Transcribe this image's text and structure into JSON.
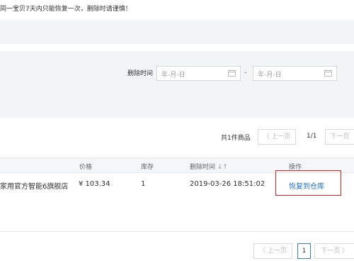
{
  "notice": "同一宝贝7天内只能恢复一次，删除时请谨慎！",
  "filter": {
    "label": "删除时间",
    "start_placeholder": "年-月-日",
    "end_placeholder": "年-月-日",
    "separator": "-"
  },
  "summary": {
    "count_text": "共1件商品",
    "page_indicator": "1/1"
  },
  "pagination_top": {
    "prev": "〈 上一页",
    "next": "下一页"
  },
  "table": {
    "headers": {
      "price": "价格",
      "stock": "库存",
      "deleted_time": "删除时间",
      "sort_icon": "↓↑",
      "action": "操作"
    },
    "rows": [
      {
        "shop": "家用官方智能6旗舰店",
        "price": "¥ 103.34",
        "stock": "1",
        "deleted_time": "2019-03-26 18:51:02",
        "action": "恢复到仓库"
      }
    ]
  },
  "pagination_bottom": {
    "prev": "〈 上一页",
    "current": "1",
    "next": "下一页 〉"
  },
  "colors": {
    "link": "#1f70d6",
    "highlight": "#e02020",
    "band": "#f3f4f6"
  }
}
